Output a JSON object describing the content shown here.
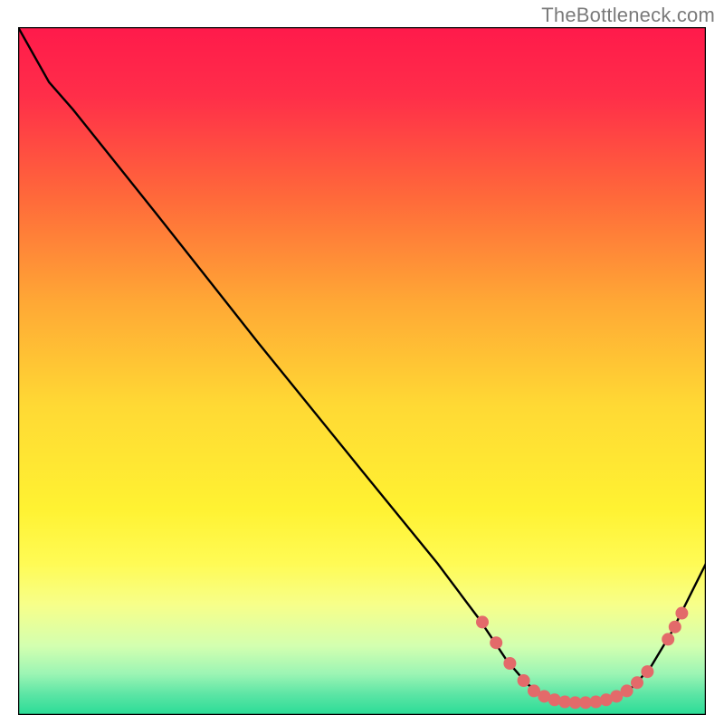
{
  "attribution": "TheBottleneck.com",
  "chart_data": {
    "type": "line",
    "title": "",
    "xlabel": "",
    "ylabel": "",
    "xlim": [
      0,
      100
    ],
    "ylim": [
      0,
      100
    ],
    "gradient_stops": [
      {
        "offset": 0.0,
        "color": "#ff1a4b"
      },
      {
        "offset": 0.1,
        "color": "#ff2e49"
      },
      {
        "offset": 0.25,
        "color": "#ff6a3a"
      },
      {
        "offset": 0.4,
        "color": "#ffa835"
      },
      {
        "offset": 0.55,
        "color": "#ffd934"
      },
      {
        "offset": 0.7,
        "color": "#fff232"
      },
      {
        "offset": 0.78,
        "color": "#fffb55"
      },
      {
        "offset": 0.84,
        "color": "#f7ff8a"
      },
      {
        "offset": 0.9,
        "color": "#d3ffb0"
      },
      {
        "offset": 0.94,
        "color": "#9cf5b4"
      },
      {
        "offset": 0.97,
        "color": "#5ce5a5"
      },
      {
        "offset": 1.0,
        "color": "#2adc96"
      }
    ],
    "curve": [
      {
        "x": 0.0,
        "y": 100.0
      },
      {
        "x": 4.5,
        "y": 92.0
      },
      {
        "x": 8.0,
        "y": 88.0
      },
      {
        "x": 20.0,
        "y": 73.0
      },
      {
        "x": 35.0,
        "y": 54.0
      },
      {
        "x": 50.0,
        "y": 35.5
      },
      {
        "x": 61.0,
        "y": 22.0
      },
      {
        "x": 67.0,
        "y": 14.0
      },
      {
        "x": 71.0,
        "y": 8.0
      },
      {
        "x": 74.0,
        "y": 4.5
      },
      {
        "x": 77.0,
        "y": 2.5
      },
      {
        "x": 80.0,
        "y": 1.8
      },
      {
        "x": 84.0,
        "y": 1.8
      },
      {
        "x": 87.0,
        "y": 2.5
      },
      {
        "x": 89.5,
        "y": 4.2
      },
      {
        "x": 92.0,
        "y": 7.0
      },
      {
        "x": 95.0,
        "y": 12.0
      },
      {
        "x": 98.0,
        "y": 18.0
      },
      {
        "x": 100.0,
        "y": 22.0
      }
    ],
    "markers": [
      {
        "x": 67.5,
        "y": 13.5
      },
      {
        "x": 69.5,
        "y": 10.5
      },
      {
        "x": 71.5,
        "y": 7.5
      },
      {
        "x": 73.5,
        "y": 5.0
      },
      {
        "x": 75.0,
        "y": 3.5
      },
      {
        "x": 76.5,
        "y": 2.7
      },
      {
        "x": 78.0,
        "y": 2.2
      },
      {
        "x": 79.5,
        "y": 1.9
      },
      {
        "x": 81.0,
        "y": 1.8
      },
      {
        "x": 82.5,
        "y": 1.8
      },
      {
        "x": 84.0,
        "y": 1.9
      },
      {
        "x": 85.5,
        "y": 2.2
      },
      {
        "x": 87.0,
        "y": 2.7
      },
      {
        "x": 88.5,
        "y": 3.5
      },
      {
        "x": 90.0,
        "y": 4.7
      },
      {
        "x": 91.5,
        "y": 6.3
      },
      {
        "x": 94.5,
        "y": 11.0
      },
      {
        "x": 95.5,
        "y": 12.8
      },
      {
        "x": 96.5,
        "y": 14.8
      }
    ],
    "colors": {
      "curve_stroke": "#000000",
      "marker_fill": "#e36a6a",
      "frame_stroke": "#000000"
    }
  }
}
